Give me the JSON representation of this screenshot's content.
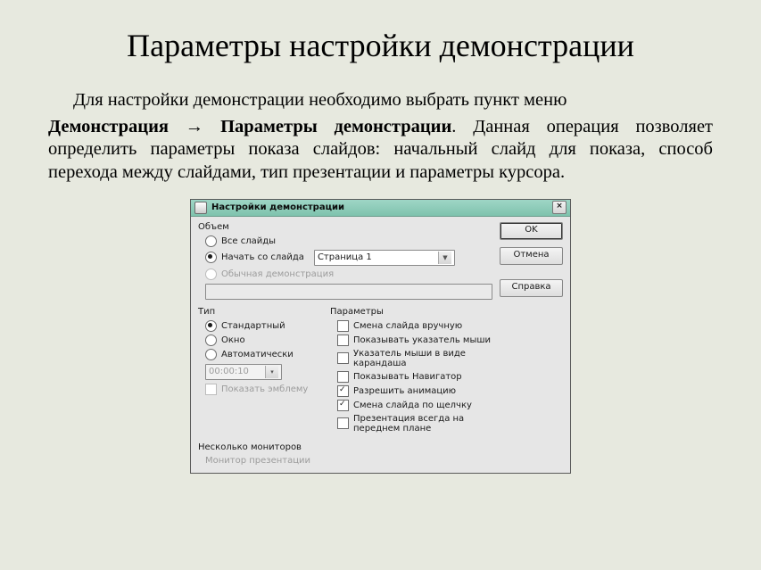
{
  "title": "Параметры настройки демонстрации",
  "lead": "Для настройки демонстрации необходимо выбрать пункт меню",
  "body_prefix_bold": "Демонстрация → Параметры демонстрации",
  "body_rest": ". Данная операция позволяет определить параметры показа слайдов: начальный слайд для показа, способ перехода между слайдами, тип презентации и параметры курсора.",
  "dlg": {
    "title": "Настройки демонстрации",
    "buttons": {
      "ok": "OK",
      "cancel": "Отмена",
      "help": "Справка"
    },
    "close": "×",
    "volume": {
      "legend": "Объем",
      "all": "Все слайды",
      "from": "Начать со слайда",
      "custom": "Обычная демонстрация",
      "page": "Страница 1"
    },
    "type": {
      "legend": "Тип",
      "std": "Стандартный",
      "win": "Окно",
      "auto": "Автоматически",
      "time": "00:00:10",
      "logo": "Показать эмблему"
    },
    "params": {
      "legend": "Параметры",
      "p1": "Смена слайда вручную",
      "p2": "Показывать указатель мыши",
      "p3": "Указатель мыши в виде карандаша",
      "p4": "Показывать Навигатор",
      "p5": "Разрешить анимацию",
      "p6": "Смена слайда по щелчку",
      "p7": "Презентация всегда на переднем плане"
    },
    "monitors": {
      "legend": "Несколько мониторов",
      "label": "Монитор презентации"
    }
  }
}
